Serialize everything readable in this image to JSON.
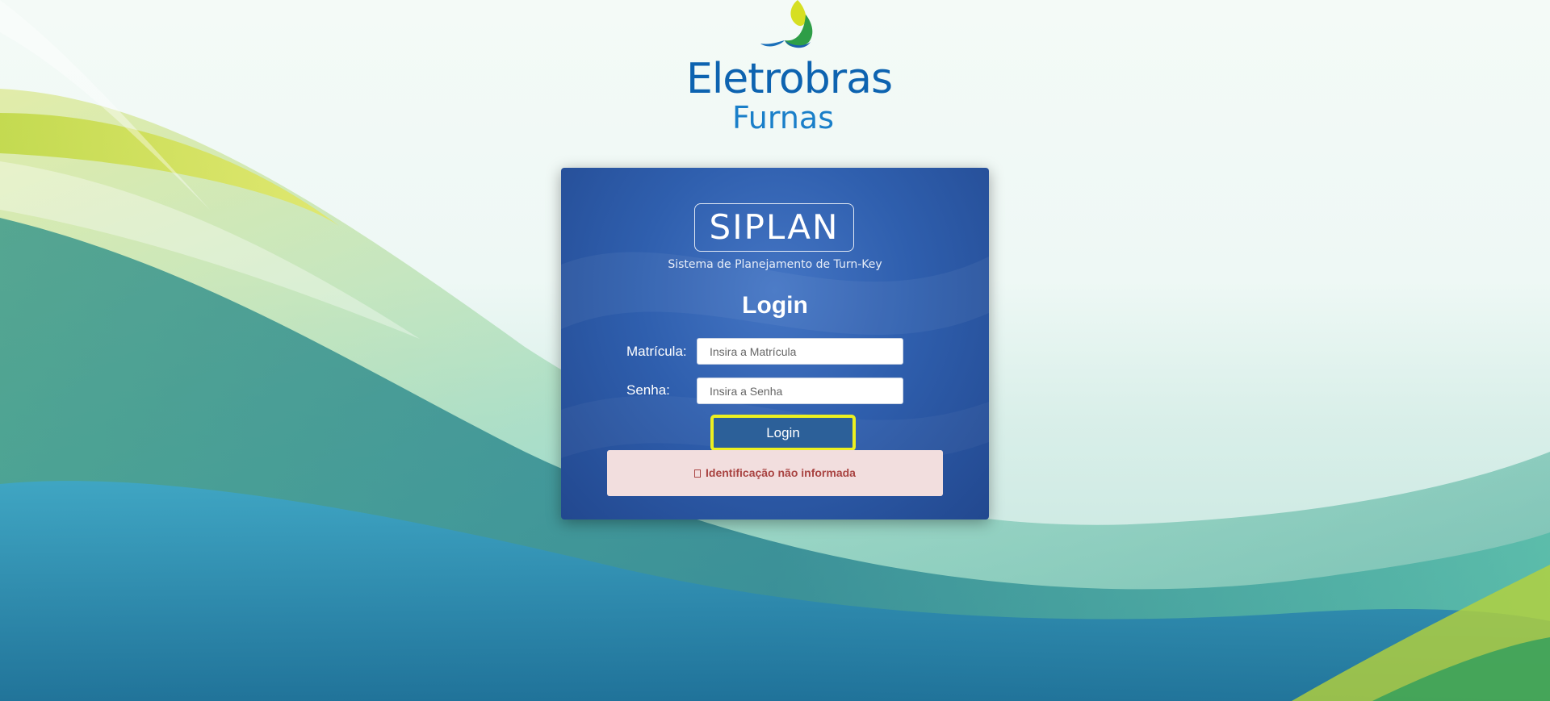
{
  "brand": {
    "name": "Eletrobras",
    "sub": "Furnas",
    "logo_icon": "eletrobras-drop-logo"
  },
  "app": {
    "name": "SIPLAN",
    "subtitle": "Sistema de Planejamento de Turn-Key"
  },
  "login": {
    "title": "Login",
    "matricula_label": "Matrícula:",
    "matricula_value": "",
    "matricula_placeholder": "Insira a Matrícula",
    "senha_label": "Senha:",
    "senha_value": "",
    "senha_placeholder": "Insira a Senha",
    "button_label": "Login"
  },
  "error": {
    "message": "Identificação não informada",
    "icon": "warning-icon"
  },
  "colors": {
    "brand_blue": "#0d63b0",
    "card_blue": "#2f5fae",
    "button_blue": "#2c6099",
    "focus_outline": "#ecf020",
    "error_bg": "#f2dede",
    "error_text": "#a94442"
  }
}
